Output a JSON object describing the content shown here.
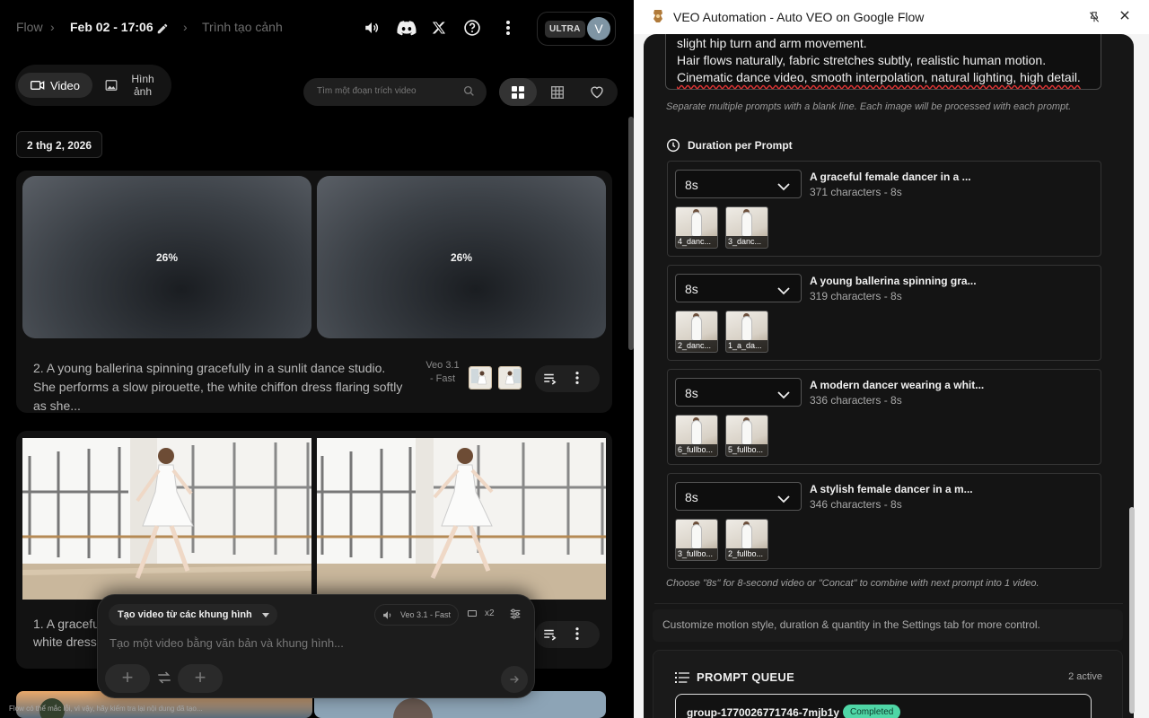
{
  "flow": {
    "breadcrumb": {
      "home": "Flow",
      "project": "Feb 02 - 17:06",
      "scene": "Trình tạo cảnh"
    },
    "account": {
      "plan": "ULTRA",
      "avatar_letter": "V"
    },
    "tabs": {
      "video": "Video",
      "image": "Hình ảnh"
    },
    "search_placeholder": "Tìm một đoạn trích video",
    "date_label": "2 thg 2, 2026",
    "card1": {
      "progress_a": "26%",
      "progress_b": "26%",
      "prompt": "2. A young ballerina spinning gracefully in a sunlit dance studio. She performs a slow pirouette, the white chiffon dress flaring softly as she...",
      "model": "Veo 3.1 - Fast"
    },
    "card2": {
      "prompt": "1. A graceful white dress."
    },
    "composer": {
      "mode": "Tạo video từ các khung hình",
      "model": "Veo 3.1 - Fast",
      "count": "x2",
      "placeholder": "Tạo một video bằng văn bản và khung hình..."
    },
    "footer_note": "Flow có thể mắc lỗi, vì vậy, hãy kiểm tra lại nội dung đã tạo..."
  },
  "panel": {
    "title": "VEO Automation - Auto VEO on Google Flow",
    "textarea_lines": [
      "slight hip turn and arm movement.",
      "Hair flows naturally, fabric stretches subtly, realistic human motion.",
      "Cinematic dance video, smooth interpolation, natural lighting, high detail."
    ],
    "hint": "Separate multiple prompts with a blank line. Each image will be processed with each prompt.",
    "duration_heading": "Duration per Prompt",
    "prompts": [
      {
        "duration": "8s",
        "title": "A graceful female dancer in a ...",
        "meta": "371 characters - 8s",
        "images": [
          "4_danc...",
          "3_danc..."
        ]
      },
      {
        "duration": "8s",
        "title": "A young ballerina spinning gra...",
        "meta": "319 characters - 8s",
        "images": [
          "2_danc...",
          "1_a_da..."
        ]
      },
      {
        "duration": "8s",
        "title": "A modern dancer wearing a whit...",
        "meta": "336 characters - 8s",
        "images": [
          "6_fullbo...",
          "5_fullbo..."
        ]
      },
      {
        "duration": "8s",
        "title": "A stylish female dancer in a m...",
        "meta": "346 characters - 8s",
        "images": [
          "3_fullbo...",
          "2_fullbo..."
        ]
      }
    ],
    "choose_hint": "Choose \"8s\" for 8-second video or \"Concat\" to combine with next prompt into 1 video.",
    "customize_hint": "Customize motion style, duration & quantity in the Settings tab for more control.",
    "queue": {
      "heading": "PROMPT QUEUE",
      "count": "2 active",
      "item_id": "group-1770026771746-7mjb1y",
      "item_status": "Completed"
    }
  },
  "colors": {
    "accent_completed": "#4fd6a6",
    "panel_bg": "#161616",
    "flow_bg": "#000000"
  }
}
